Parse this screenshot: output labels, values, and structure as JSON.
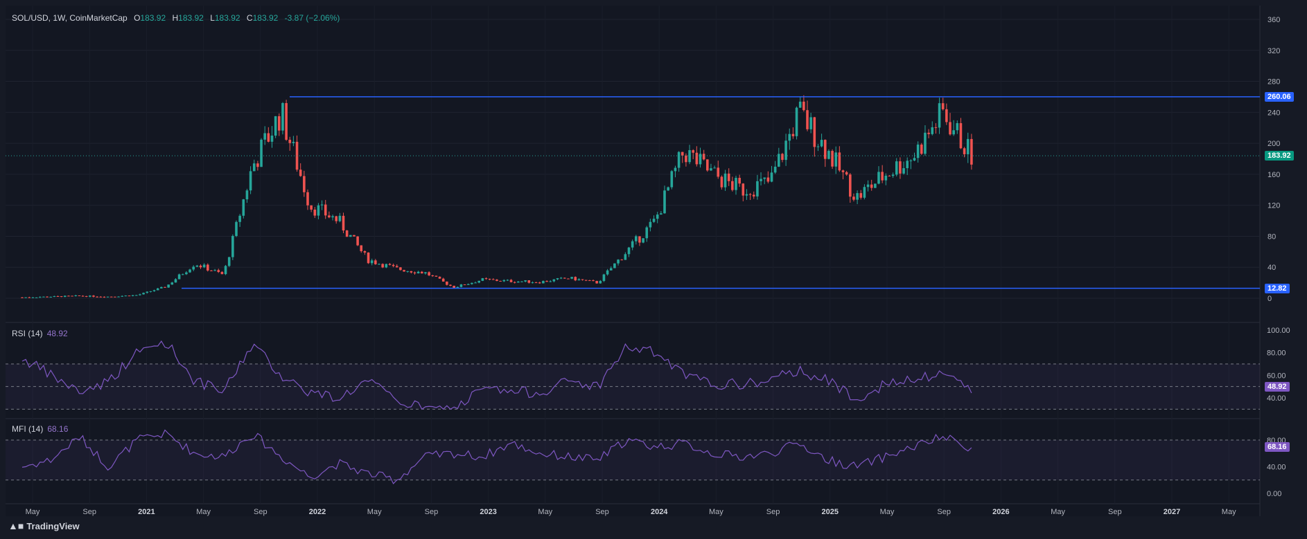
{
  "header": {
    "symbol": "SOL/USD, 1W, CoinMarketCap",
    "o_label": "O",
    "o": "183.92",
    "h_label": "H",
    "h": "183.92",
    "l_label": "L",
    "l": "183.92",
    "c_label": "C",
    "c": "183.92",
    "change": "-3.87 (−2.06%)"
  },
  "rsi": {
    "title": "RSI (14)",
    "value": "48.92",
    "axis": [
      "100.00",
      "80.00",
      "60.00",
      "40.00"
    ]
  },
  "mfi": {
    "title": "MFI (14)",
    "value": "68.16",
    "axis": [
      "80.00",
      "40.00",
      "0.00"
    ]
  },
  "price_axis": [
    "360",
    "320",
    "280",
    "240",
    "200",
    "160",
    "120",
    "80",
    "40",
    "0"
  ],
  "tags": {
    "resistance": "260.06",
    "current": "183.92",
    "support": "12.82"
  },
  "x_labels": [
    "May",
    "Sep",
    "2021",
    "May",
    "Sep",
    "2022",
    "May",
    "Sep",
    "2023",
    "May",
    "Sep",
    "2024",
    "May",
    "Sep",
    "2025",
    "May",
    "Sep",
    "2026",
    "May",
    "Sep",
    "2027",
    "May"
  ],
  "brand": "TradingView",
  "colors": {
    "up": "#26a69a",
    "down": "#ef5350",
    "level": "#2962ff",
    "indicator": "#7e57c2"
  },
  "chart_data": {
    "type": "candlestick",
    "title": "SOL/USD, 1W, CoinMarketCap",
    "ylim": [
      0,
      370
    ],
    "horizontal_lines": [
      260.06,
      12.82
    ],
    "last_price": 183.92,
    "x": [
      "2020-05",
      "2020-07",
      "2020-09",
      "2020-11",
      "2021-01",
      "2021-03",
      "2021-05",
      "2021-07",
      "2021-09",
      "2021-11",
      "2022-01",
      "2022-03",
      "2022-05",
      "2022-07",
      "2022-09",
      "2022-11",
      "2023-01",
      "2023-03",
      "2023-05",
      "2023-07",
      "2023-09",
      "2023-11",
      "2024-01",
      "2024-03",
      "2024-05",
      "2024-07",
      "2024-09",
      "2024-11",
      "2025-01",
      "2025-03",
      "2025-05",
      "2025-07",
      "2025-09",
      "2025-10"
    ],
    "series": [
      {
        "name": "price",
        "values": [
          1,
          2,
          3,
          2,
          4,
          15,
          45,
          30,
          170,
          240,
          120,
          100,
          50,
          38,
          33,
          14,
          24,
          22,
          21,
          26,
          20,
          60,
          100,
          190,
          160,
          140,
          150,
          240,
          190,
          130,
          160,
          185,
          240,
          183.92
        ]
      },
      {
        "name": "RSI (14)",
        "values": [
          75,
          60,
          45,
          55,
          80,
          90,
          55,
          45,
          88,
          60,
          45,
          40,
          55,
          38,
          30,
          30,
          48,
          45,
          45,
          55,
          50,
          85,
          80,
          60,
          52,
          52,
          55,
          65,
          55,
          40,
          52,
          55,
          62,
          48.92
        ]
      },
      {
        "name": "MFI (14)",
        "values": [
          40,
          50,
          85,
          40,
          80,
          90,
          60,
          55,
          90,
          55,
          25,
          45,
          30,
          20,
          55,
          60,
          55,
          75,
          60,
          55,
          50,
          80,
          70,
          75,
          60,
          55,
          60,
          75,
          50,
          40,
          55,
          70,
          85,
          68.16
        ]
      }
    ]
  }
}
